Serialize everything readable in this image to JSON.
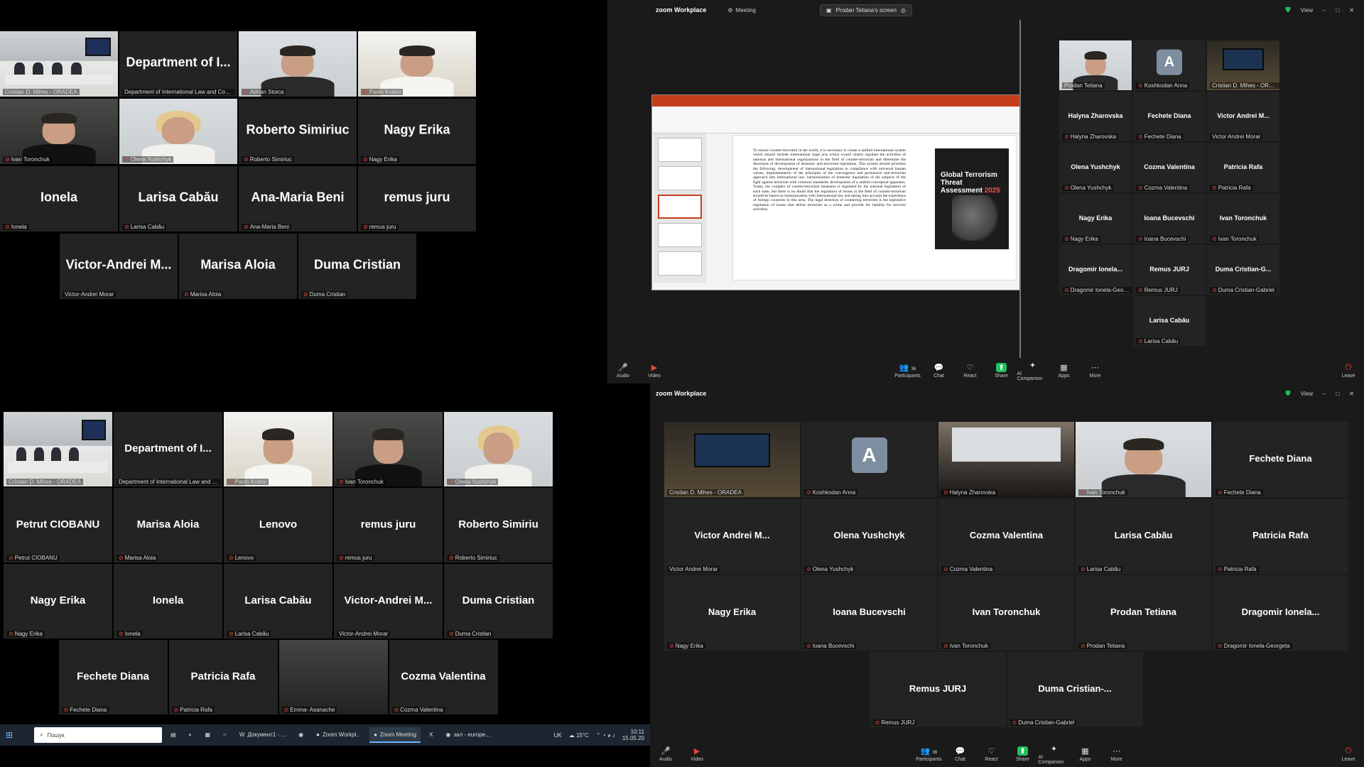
{
  "colors": {
    "active_border": "#21c15c",
    "mic_muted": "#e0453c",
    "tile_bg": "#232323",
    "bar_bg": "#1a1a1a"
  },
  "top_left": {
    "rows": [
      [
        {
          "big": "",
          "label": "Cristian D. Mihes - ORADEA",
          "video": "panel",
          "active": true,
          "muted": false
        },
        {
          "big": "Department of I...",
          "label": "Department of International Law and Comparative L...",
          "muted": false
        },
        {
          "big": "",
          "label": "Adrian Stoica",
          "video": "office",
          "muted": true
        },
        {
          "big": "",
          "label": "Pavlo Krainii",
          "video": "room",
          "muted": true
        }
      ],
      [
        {
          "big": "",
          "label": "Ivan Toronchuk",
          "video": "dark",
          "muted": true
        },
        {
          "big": "",
          "label": "Olena Yushchyk",
          "video": "blonde",
          "muted": true
        },
        {
          "big": "Roberto Simiriuc",
          "label": "Roberto Simiriuc",
          "muted": true
        },
        {
          "big": "Nagy Erika",
          "label": "Nagy Erika",
          "muted": true
        }
      ],
      [
        {
          "big": "Ionela",
          "label": "Ionela",
          "muted": true
        },
        {
          "big": "Larisa Cabău",
          "label": "Larisa Cabău",
          "muted": true
        },
        {
          "big": "Ana-Maria Beni",
          "label": "Ana-Maria Beni",
          "muted": true
        },
        {
          "big": "remus juru",
          "label": "remus juru",
          "muted": true
        }
      ],
      [
        {
          "big": "Victor-Andrei M...",
          "label": "Victor-Andrei Morar",
          "muted": false
        },
        {
          "big": "Marisa Aloia",
          "label": "Marisa Aloia",
          "muted": true
        },
        {
          "big": "Duma Cristian",
          "label": "Duma Cristian",
          "muted": true
        }
      ]
    ]
  },
  "top_right": {
    "app_name": "zoom Workplace",
    "meeting_label": "Meeting",
    "share_label": "Prodan Tetiana's screen",
    "view_label": "View",
    "slide_text": "To ensure counter-terrorism in the world, it is necessary to create a unified international system which should include international legal acts which would clearly regulate the activities of national and international organizations in the field of counter-terrorism and determine the directions of development of domestic anti-terrorism legislation. This system should prioritize the following: development of international legislation in compliance with universal human values; implementation of the principles of the convergence and permissive anti-terrorism approach into international law; harmonization of domestic legislation of the subjects of the fight against terrorism with common standards; development of a unified conceptual apparatus. Today, the complex of counter-terrorism measures is regulated by the national legislation of each state, but there is no doubt that the regulation of issues in the field of counter-terrorism should be based on harmonization with international law and taking into account the experience of foreign countries in this area. The legal direction of countering terrorism is the legislative regulation of issues that define terrorism as a crime and provide for liability for terrorist activities.",
    "slide_title_1": "Global Terrorism Threat",
    "slide_title_2": "Assessment",
    "slide_year": "2025",
    "tiles": [
      {
        "big": "",
        "label": "Prodan Tetiana",
        "video": "office",
        "active": true,
        "muted": false
      },
      {
        "big": "",
        "avatar": "A",
        "label": "Koshkodan Anna",
        "muted": true
      },
      {
        "big": "",
        "label": "Cristian D. Mihes - ORADEA",
        "video": "hall",
        "muted": false
      },
      {
        "big": "Halyna Zharovska",
        "label": "Halyna Zharovska",
        "muted": true
      },
      {
        "big": "Fechete Diana",
        "label": "Fechete Diana",
        "muted": true
      },
      {
        "big": "Victor Andrei M...",
        "label": "Victor Andrei Morar",
        "muted": false
      },
      {
        "big": "Olena Yushchyk",
        "label": "Olena Yushchyk",
        "muted": true
      },
      {
        "big": "Cozma Valentina",
        "label": "Cozma Valentina",
        "muted": true
      },
      {
        "big": "Patricia Rafa",
        "label": "Patricia Rafa",
        "muted": true
      },
      {
        "big": "Nagy Erika",
        "label": "Nagy Erika",
        "muted": true
      },
      {
        "big": "Ioana Bucevschi",
        "label": "Ioana Bucevschi",
        "muted": true
      },
      {
        "big": "Ivan Toronchuk",
        "label": "Ivan Toronchuk",
        "muted": true
      },
      {
        "big": "Dragomir Ionela...",
        "label": "Dragomir Ionela-Georgeta",
        "muted": true
      },
      {
        "big": "Remus JURJ",
        "label": "Remus JURJ",
        "muted": true
      },
      {
        "big": "Duma Cristian-G...",
        "label": "Duma Cristian-Gabriel",
        "muted": true
      },
      {
        "big": "Larisa Cabău",
        "label": "Larisa Cabău",
        "muted": true
      }
    ],
    "toolbar": {
      "audio": "Audio",
      "video": "Video",
      "participants": "Participants",
      "participants_count": "36",
      "chat": "Chat",
      "react": "React",
      "share": "Share",
      "ai": "AI Companion",
      "apps": "Apps",
      "more": "More",
      "leave": "Leave"
    }
  },
  "bottom_left": {
    "rows": [
      [
        {
          "big": "",
          "label": "Cristian D. Mihes - ORADEA",
          "video": "panel",
          "muted": false
        },
        {
          "big": "Department of I...",
          "label": "Department of International Law and Comparative L...",
          "muted": false
        },
        {
          "big": "",
          "label": "Pavlo Krainii",
          "video": "room",
          "active": true,
          "muted": true
        },
        {
          "big": "",
          "label": "Ivan Toronchuk",
          "video": "dark",
          "muted": true
        },
        {
          "big": "",
          "label": "Olena Yushchyk",
          "video": "blonde",
          "muted": true
        }
      ],
      [
        {
          "big": "Petrut CIOBANU",
          "label": "Petrut CIOBANU",
          "muted": true
        },
        {
          "big": "Marisa Aloia",
          "label": "Marisa Aloia",
          "muted": true
        },
        {
          "big": "Lenovo",
          "label": "Lenovo",
          "muted": true
        },
        {
          "big": "remus juru",
          "label": "remus juru",
          "muted": true
        },
        {
          "big": "Roberto Simiriu",
          "label": "Roberto Simiriuc",
          "muted": true
        }
      ],
      [
        {
          "big": "Nagy Erika",
          "label": "Nagy Erika",
          "muted": true
        },
        {
          "big": "Ionela",
          "label": "Ionela",
          "muted": true
        },
        {
          "big": "Larisa Cabău",
          "label": "Larisa Cabău",
          "muted": true
        },
        {
          "big": "Victor-Andrei M...",
          "label": "Victor-Andrei Morar",
          "muted": false
        },
        {
          "big": "Duma Cristian",
          "label": "Duma Cristian",
          "muted": true
        }
      ],
      [
        {
          "big": "Fechete Diana",
          "label": "Fechete Diana",
          "muted": true
        },
        {
          "big": "Patricia Rafa",
          "label": "Patricia Rafa",
          "muted": true
        },
        {
          "big": "",
          "label": "Emma- Asanache",
          "video": "phone",
          "muted": true
        },
        {
          "big": "Cozma Valentina",
          "label": "Cozma Valentina",
          "muted": true
        }
      ]
    ],
    "taskbar": {
      "search_placeholder": "Пошук",
      "apps": [
        "Документ1 - ...",
        "Zoom Workpl...",
        "Zoom Meeting",
        "зал - europe..."
      ],
      "lang": "UK",
      "weather": "15°C",
      "time": "10:11",
      "date": "15.05.20"
    }
  },
  "bottom_right": {
    "app_name": "zoom Workplace",
    "view_label": "View",
    "rows": [
      [
        {
          "big": "",
          "label": "Cristian D. Mihes - ORADEA",
          "video": "hall",
          "muted": false
        },
        {
          "big": "",
          "avatar": "A",
          "label": "Koshkodan Anna",
          "muted": true
        },
        {
          "big": "",
          "label": "Halyna Zharovska",
          "video": "conf",
          "active": true,
          "muted": true
        },
        {
          "big": "",
          "label": "Ivan Toronchuk",
          "video": "office",
          "muted": true
        },
        {
          "big": "Fechete Diana",
          "label": "Fechete Diana",
          "muted": true
        }
      ],
      [
        {
          "big": "Victor Andrei M...",
          "label": "Victor Andrei Morar",
          "muted": false
        },
        {
          "big": "Olena Yushchyk",
          "label": "Olena Yushchyk",
          "muted": true
        },
        {
          "big": "Cozma Valentina",
          "label": "Cozma Valentina",
          "muted": true
        },
        {
          "big": "Larisa Cabău",
          "label": "Larisa Cabău",
          "muted": true
        },
        {
          "big": "Patricia Rafa",
          "label": "Patricia Rafa",
          "muted": true
        }
      ],
      [
        {
          "big": "Nagy Erika",
          "label": "Nagy Erika",
          "muted": true
        },
        {
          "big": "Ioana Bucevschi",
          "label": "Ioana Bucevschi",
          "muted": true
        },
        {
          "big": "Ivan Toronchuk",
          "label": "Ivan Toronchuk",
          "muted": true
        },
        {
          "big": "Prodan Tetiana",
          "label": "Prodan Tetiana",
          "muted": true
        },
        {
          "big": "Dragomir Ionela...",
          "label": "Dragomir Ionela-Georgeta",
          "muted": true
        }
      ],
      [
        {
          "big": "Remus JURJ",
          "label": "Remus JURJ",
          "muted": true
        },
        {
          "big": "Duma Cristian-...",
          "label": "Duma Cristian-Gabriel",
          "muted": true
        }
      ]
    ],
    "toolbar": {
      "audio": "Audio",
      "video": "Video",
      "participants": "Participants",
      "participants_count": "36",
      "chat": "Chat",
      "react": "React",
      "share": "Share",
      "ai": "AI Companion",
      "apps": "Apps",
      "more": "More",
      "leave": "Leave"
    }
  }
}
